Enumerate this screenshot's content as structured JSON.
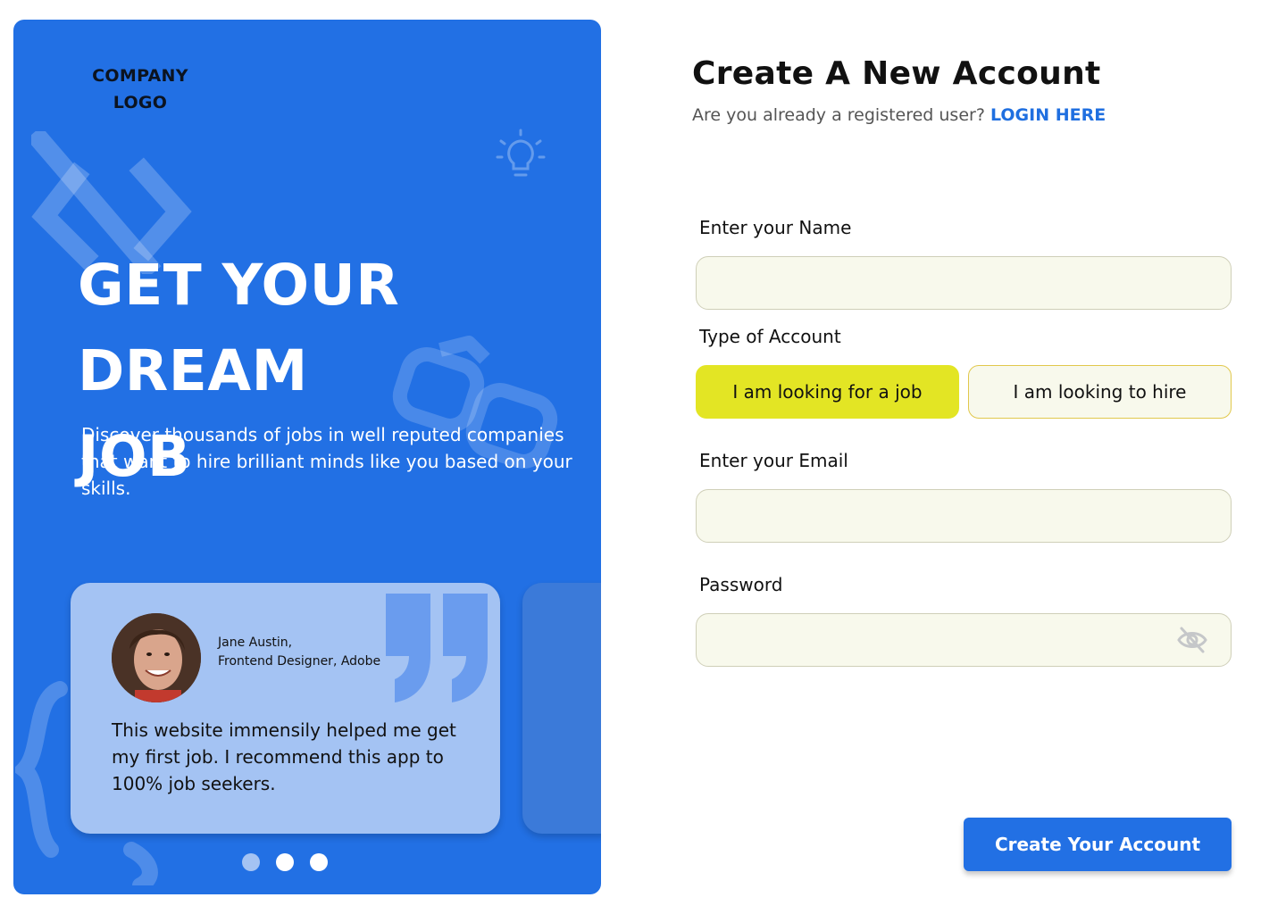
{
  "brand": {
    "logo_line1": "COMPANY",
    "logo_line2": "LOGO"
  },
  "hero": {
    "headline_line1": "GET YOUR DREAM",
    "headline_line2": "JOB",
    "description": "Discover thousands of jobs in well reputed companies that want to hire brilliant minds like you based on your skills."
  },
  "testimonial": {
    "author_name": "Jane Austin,",
    "author_role": "Frontend Designer, Adobe",
    "quote": "This website immensily helped me get my first job. I recommend this app to 100% job seekers."
  },
  "carousel": {
    "slides": 3,
    "active_index": 0
  },
  "form": {
    "title": "Create A New Account",
    "login_prompt": "Are you already a registered user?",
    "login_link": "LOGIN HERE",
    "name_label": "Enter your Name",
    "name_value": "",
    "account_type_label": "Type of Account",
    "account_types": [
      "I am looking for a job",
      "I am looking to hire"
    ],
    "selected_account_type": "I am looking for a job",
    "email_label": "Enter your Email",
    "email_value": "",
    "password_label": "Password",
    "password_value": "",
    "password_toggle_icon": "eye-off-icon",
    "submit_label": "Create Your Account"
  },
  "colors": {
    "primary": "#2270e4",
    "accent": "#e3e524",
    "field_bg": "#f8f9ec",
    "card_bg": "#a4c3f3",
    "link": "#1f6fe0"
  }
}
